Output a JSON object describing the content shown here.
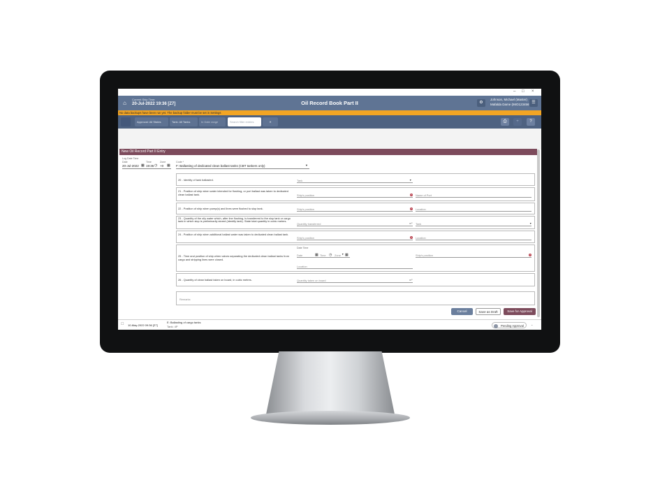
{
  "window": {
    "minimize": "–",
    "maximize": "□",
    "close": "×"
  },
  "header": {
    "time_label": "Current Ship Time:",
    "time_value": "20-Jul-2022 19:36 [Z7]",
    "title": "Oil Record Book Part II",
    "user_line1": "Johnson, Michael (Master)",
    "user_line2": "Mafalda Dame (IMO1234567)"
  },
  "warning": "No data backups have been run yet. The backup folder must be set in Settings",
  "filters": {
    "approval": "Approval: All States",
    "tank": "Tank: All Tanks",
    "date_range": "In Date range",
    "search_placeholder": "Search filter entries",
    "clear": "✕"
  },
  "entry": {
    "heading": "New Oil Record Part II Entry",
    "log_time_label": "Log Date Time",
    "date_label": "Date",
    "date_value": "20-Jul-2022",
    "time_label": "Time",
    "time_value": "19:36",
    "zone_label": "Zone",
    "zone_value": "+0",
    "code_label": "Code *",
    "code_value": "F: Ballasting of dedicated clean ballast tanks (CBT tankers only)"
  },
  "items": [
    {
      "desc": "20 - Identity of tank ballasted.",
      "f1": "Tank"
    },
    {
      "desc": "21 - Position of ship when water intended for flushing, or port ballast was taken to dedicated clean ballast tank.",
      "f1": "Ship's position",
      "f2": "Name of Port"
    },
    {
      "desc": "22 - Position of ship when pump(s) and lines were flushed to slop tank.",
      "f1": "Ship's position",
      "f2": "Location"
    },
    {
      "desc": "23 - Quantity of the oily water which, after line flushing, is transferred to the slop tank or cargo tank in which slop is preliminarily stored (identify tank). State total quantity in cubic metres.",
      "f1": "Quantity transferred",
      "unit": "m³",
      "f2": "Tank"
    },
    {
      "desc": "24 - Position of ship when additional ballast water was taken to dedicated clean ballast tank.",
      "f1": "Ship's position",
      "f2": "Location"
    },
    {
      "desc": "25 - Time and position of ship when valves separating the dedicated clean ballast tanks from cargo and stripping lines were closed.",
      "dt_label": "Date Time",
      "date": "Date",
      "time": "Time",
      "zone": "Zone",
      "location": "Location",
      "f2": "Ship's position"
    },
    {
      "desc": "26 - Quantity of clean ballast taken on board, in cubic metres.",
      "f1": "Quantity taken on board",
      "unit": "m³"
    }
  ],
  "remarks": "Remarks",
  "actions": {
    "cancel": "Cancel",
    "draft": "Save as Draft",
    "approve": "Save for Approval"
  },
  "record": {
    "date": "10-May-2022 09:36 [Z7]",
    "code": "E: Ballasting of cargo tanks",
    "tank": "Tank: 4P",
    "status": "Pending Approval"
  }
}
